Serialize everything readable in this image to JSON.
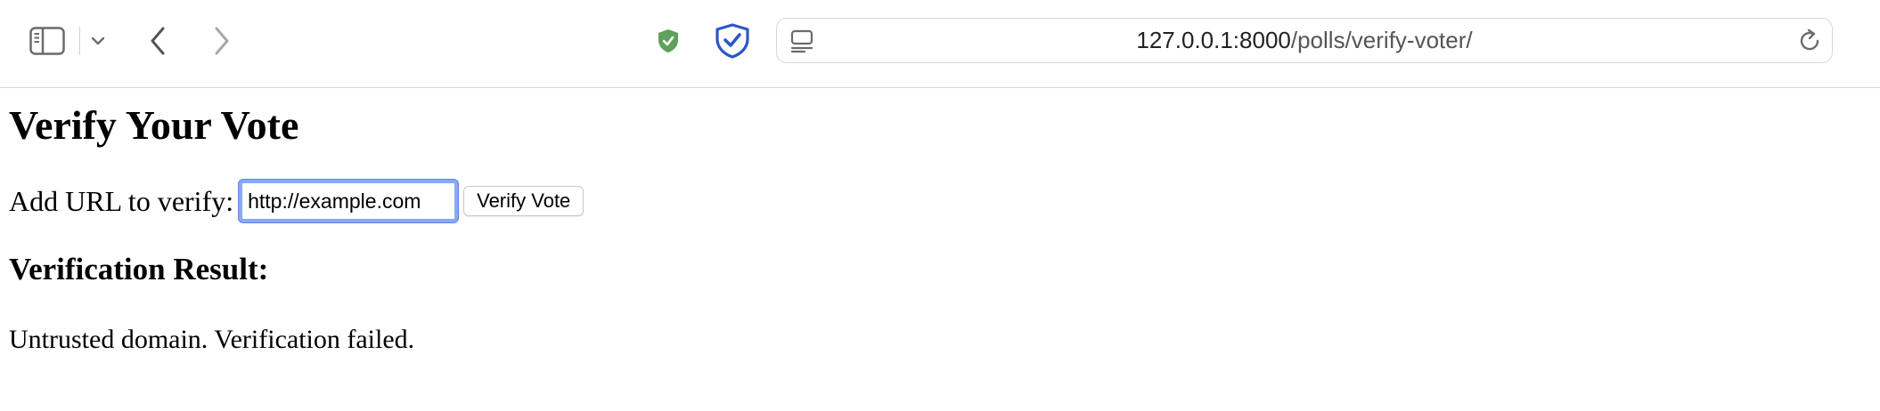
{
  "browser": {
    "url_host": "127.0.0.1:8000",
    "url_path": "/polls/verify-voter/",
    "icons": {
      "sidebar": "sidebar-icon",
      "tab_overview": "chevron-down-icon",
      "back": "chevron-left-icon",
      "forward": "chevron-right-icon",
      "extension_1": "green-shield-icon",
      "extension_2": "blue-shield-check-icon",
      "page_menu": "page-menu-icon",
      "reload": "reload-icon"
    },
    "colors": {
      "shield_green": "#5fa05a",
      "shield_blue": "#2b57c7",
      "focus_ring": "#8aaaf0"
    }
  },
  "page": {
    "title": "Verify Your Vote",
    "form": {
      "label": "Add URL to verify:",
      "input_value": "http://example.com",
      "button_label": "Verify Vote"
    },
    "result_heading": "Verification Result:",
    "result_text": "Untrusted domain. Verification failed."
  }
}
